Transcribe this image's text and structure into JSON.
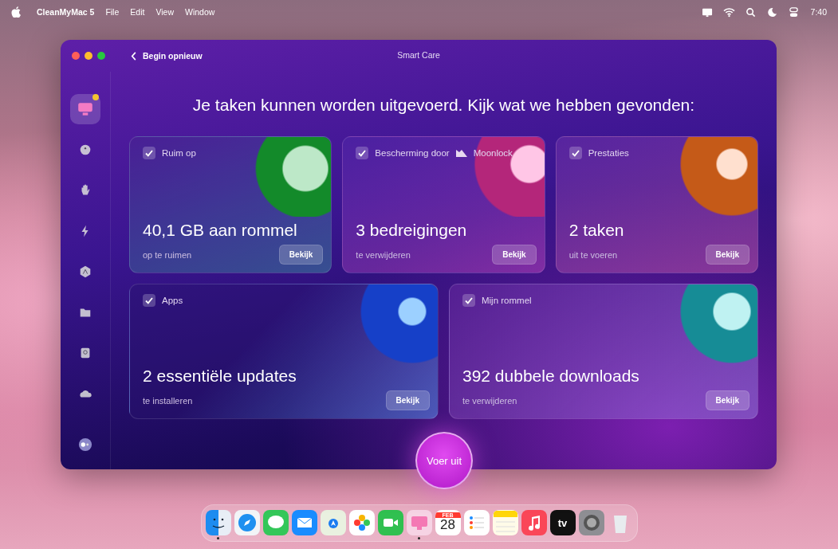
{
  "menu_bar": {
    "app_name": "CleanMyMac 5",
    "menus": [
      "File",
      "Edit",
      "View",
      "Window"
    ],
    "clock": "7:40"
  },
  "window": {
    "title": "Smart Care",
    "back_label": "Begin opnieuw"
  },
  "sidebar": {
    "items": [
      {
        "kind": "care",
        "selected": true,
        "badge": true
      },
      {
        "kind": "disk",
        "selected": false,
        "badge": false
      },
      {
        "kind": "hand",
        "selected": false,
        "badge": false
      },
      {
        "kind": "bolt",
        "selected": false,
        "badge": false
      },
      {
        "kind": "apps",
        "selected": false,
        "badge": false
      },
      {
        "kind": "folder",
        "selected": false,
        "badge": false
      },
      {
        "kind": "drive",
        "selected": false,
        "badge": false
      },
      {
        "kind": "cloud",
        "selected": false,
        "badge": false
      }
    ],
    "footer": true
  },
  "headline": "Je taken kunnen worden uitgevoerd. Kijk wat we hebben gevonden:",
  "cards": [
    {
      "kind": "cleanup",
      "label": "Ruim op",
      "checked": true,
      "value": "40,1 GB aan rommel",
      "detail": "op te ruimen",
      "button": "Bekijk"
    },
    {
      "kind": "protection",
      "label": "Bescherming door",
      "brand": "Moonlock",
      "checked": true,
      "value": "3 bedreigingen",
      "detail": "te verwijderen",
      "button": "Bekijk"
    },
    {
      "kind": "performance",
      "label": "Prestaties",
      "checked": true,
      "value": "2 taken",
      "detail": "uit te voeren",
      "button": "Bekijk"
    },
    {
      "kind": "apps",
      "label": "Apps",
      "checked": true,
      "value": "2 essentiële updates",
      "detail": "te installeren",
      "button": "Bekijk"
    },
    {
      "kind": "clutter",
      "label": "Mijn rommel",
      "checked": true,
      "value": "392 dubbele downloads",
      "detail": "te verwijderen",
      "button": "Bekijk"
    }
  ],
  "run_button": "Voer uit",
  "dock": [
    {
      "kind": "finder",
      "running": true
    },
    {
      "kind": "safari",
      "running": false
    },
    {
      "kind": "messages",
      "running": false
    },
    {
      "kind": "mail",
      "running": false
    },
    {
      "kind": "maps",
      "running": false
    },
    {
      "kind": "photos",
      "running": false
    },
    {
      "kind": "facetime",
      "running": false
    },
    {
      "kind": "cleanmymac",
      "running": true
    },
    {
      "kind": "calendar",
      "running": false,
      "month": "FEB",
      "day": "28"
    },
    {
      "kind": "reminders",
      "running": false
    },
    {
      "kind": "notes",
      "running": false
    },
    {
      "kind": "music",
      "running": false
    },
    {
      "kind": "tv",
      "running": false,
      "text": "tv"
    },
    {
      "kind": "settings",
      "running": false
    },
    {
      "kind": "trash",
      "running": false
    }
  ]
}
